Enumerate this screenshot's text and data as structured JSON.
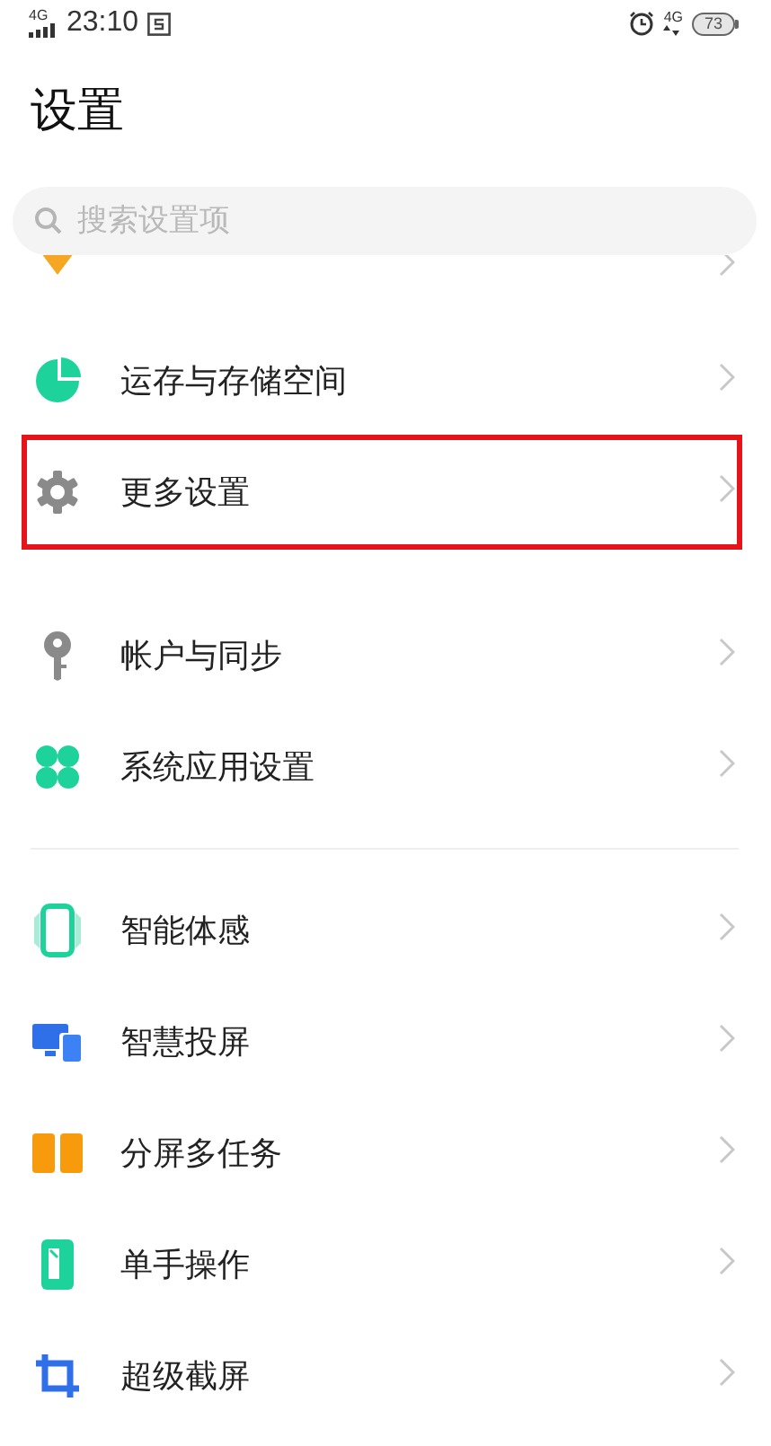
{
  "status_bar": {
    "network_left": "4G",
    "time": "23:10",
    "network_right": "4G",
    "battery": "73"
  },
  "title": "设置",
  "search": {
    "placeholder": "搜索设置项"
  },
  "groups": [
    {
      "items": [
        {
          "kind": "partial",
          "highlighted": false
        },
        {
          "kind": "row",
          "label": "运存与存储空间",
          "highlighted": false
        },
        {
          "kind": "row",
          "label": "更多设置",
          "highlighted": true
        }
      ]
    },
    {
      "separator": false,
      "items": [
        {
          "kind": "row",
          "label": "帐户与同步",
          "highlighted": false
        },
        {
          "kind": "row",
          "label": "系统应用设置",
          "highlighted": false
        }
      ]
    },
    {
      "separator": true,
      "items": [
        {
          "kind": "row",
          "label": "智能体感",
          "highlighted": false
        },
        {
          "kind": "row",
          "label": "智慧投屏",
          "highlighted": false
        },
        {
          "kind": "row",
          "label": "分屏多任务",
          "highlighted": false
        },
        {
          "kind": "row",
          "label": "单手操作",
          "highlighted": false
        },
        {
          "kind": "row",
          "label": "超级截屏",
          "highlighted": false
        }
      ]
    }
  ]
}
